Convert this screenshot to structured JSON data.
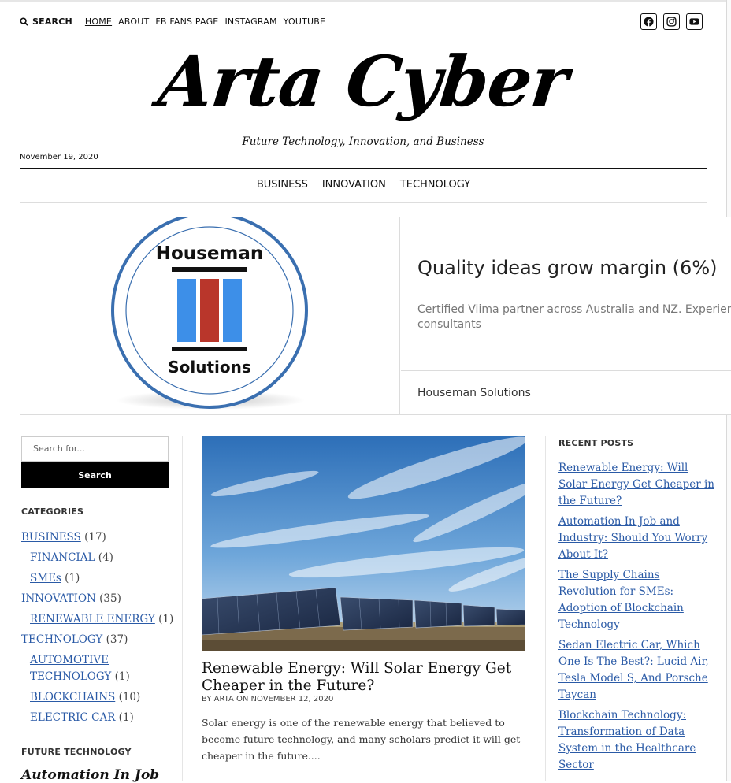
{
  "topbar": {
    "search_label": "SEARCH",
    "links": [
      "HOME",
      "ABOUT",
      "FB FANS PAGE",
      "INSTAGRAM",
      "YOUTUBE"
    ],
    "active_link": "HOME",
    "social_icons": [
      "facebook-icon",
      "instagram-icon",
      "youtube-icon"
    ]
  },
  "site": {
    "logo_text": "Arta Cyber",
    "tagline": "Future Technology, Innovation, and Business",
    "date": "November 19, 2020"
  },
  "main_nav": [
    "BUSINESS",
    "INNOVATION",
    "TECHNOLOGY"
  ],
  "ad": {
    "logo_top": "Houseman",
    "logo_bottom": "Solutions",
    "headline": "Quality ideas grow margin (6%)",
    "description": "Certified Viima partner across Australia and NZ. Experienced consultants",
    "brand": "Houseman Solutions"
  },
  "sidebar": {
    "search_placeholder": "Search for...",
    "search_button": "Search",
    "categories_title": "CATEGORIES",
    "categories": [
      {
        "name": "BUSINESS",
        "count": "(17)",
        "level": 0
      },
      {
        "name": "FINANCIAL",
        "count": "(4)",
        "level": 1
      },
      {
        "name": "SMEs",
        "count": "(1)",
        "level": 1
      },
      {
        "name": "INNOVATION",
        "count": "(35)",
        "level": 0
      },
      {
        "name": "RENEWABLE ENERGY",
        "count": "(1)",
        "level": 1
      },
      {
        "name": "TECHNOLOGY",
        "count": "(37)",
        "level": 0
      },
      {
        "name": "AUTOMOTIVE TECHNOLOGY",
        "count": "(1)",
        "level": 1
      },
      {
        "name": "BLOCKCHAINS",
        "count": "(10)",
        "level": 1
      },
      {
        "name": "ELECTRIC CAR",
        "count": "(1)",
        "level": 1
      }
    ],
    "future_title": "FUTURE TECHNOLOGY",
    "future_post": "Automation In Job"
  },
  "post": {
    "title": "Renewable Energy: Will Solar Energy Get Cheaper in the Future?",
    "meta": "BY ARTA ON NOVEMBER 12, 2020",
    "excerpt": "Solar energy is one of the renewable energy that believed to become future technology, and many scholars predict it will get cheaper in the future...."
  },
  "recent": {
    "title": "RECENT POSTS",
    "items": [
      "Renewable Energy: Will Solar Energy Get Cheaper in the Future?",
      "Automation In Job and Industry: Should You Worry About It?",
      "The Supply Chains Revolution for SMEs: Adoption of Blockchain Technology",
      "Sedan Electric Car, Which One Is The Best?: Lucid Air, Tesla Model S, And Porsche Taycan",
      "Blockchain Technology: Transformation of Data System in the Healthcare Sector"
    ]
  },
  "colors": {
    "link": "#2a5aa6",
    "button": "#000000",
    "ad_ring": "#3a6fb0",
    "ad_bar_red": "#b9362b",
    "ad_bar_blue": "#3d8fe8"
  }
}
